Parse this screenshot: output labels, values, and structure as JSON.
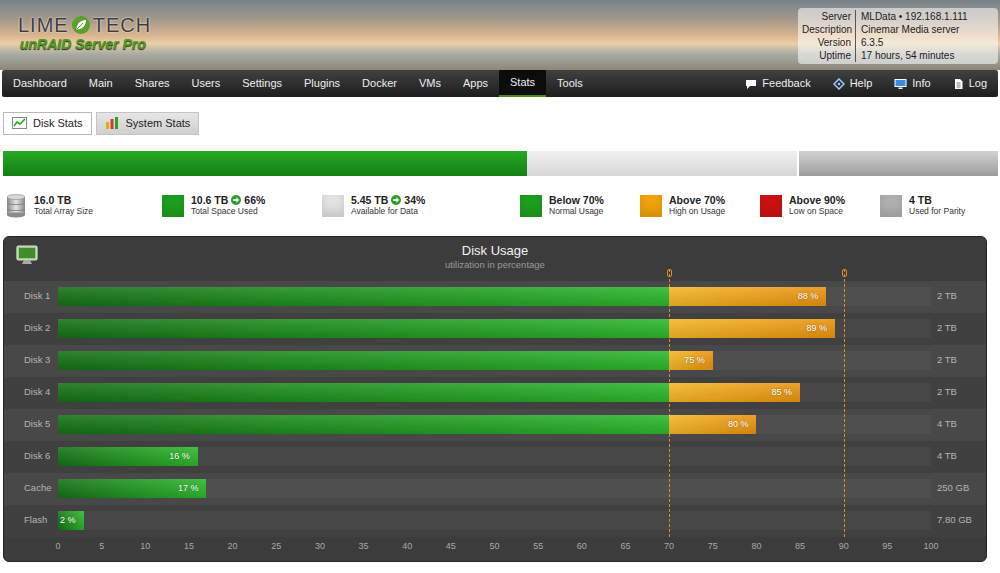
{
  "header": {
    "logo": {
      "left": "LIME",
      "right": "TECH",
      "product": "unRAID Server Pro"
    },
    "info": [
      {
        "label": "Server",
        "value": "MLData • 192.168.1.111"
      },
      {
        "label": "Description",
        "value": "Cinemar Media server"
      },
      {
        "label": "Version",
        "value": "6.3.5"
      },
      {
        "label": "Uptime",
        "value": "17 hours, 54 minutes"
      }
    ]
  },
  "nav": {
    "items": [
      {
        "label": "Dashboard",
        "selected": false
      },
      {
        "label": "Main",
        "selected": false
      },
      {
        "label": "Shares",
        "selected": false
      },
      {
        "label": "Users",
        "selected": false
      },
      {
        "label": "Settings",
        "selected": false
      },
      {
        "label": "Plugins",
        "selected": false
      },
      {
        "label": "Docker",
        "selected": false
      },
      {
        "label": "VMs",
        "selected": false
      },
      {
        "label": "Apps",
        "selected": false
      },
      {
        "label": "Stats",
        "selected": true
      },
      {
        "label": "Tools",
        "selected": false
      }
    ],
    "right": [
      {
        "label": "Feedback",
        "kind": "feedback"
      },
      {
        "label": "Help",
        "kind": "help"
      },
      {
        "label": "Info",
        "kind": "info"
      },
      {
        "label": "Log",
        "kind": "log"
      }
    ]
  },
  "tabs": [
    {
      "label": "Disk Stats",
      "selected": true
    },
    {
      "label": "System Stats",
      "selected": false
    }
  ],
  "usage_bar": {
    "used_level": 0.66,
    "parity_level": 0.2
  },
  "legend": [
    {
      "kind": "disk",
      "value": "16.0 TB",
      "caption": "Total Array Size"
    },
    {
      "kind": "swatch",
      "color": "#1e9e1e",
      "value": "10.6 TB",
      "percent": "66%",
      "caption": "Total Space Used"
    },
    {
      "kind": "swatch",
      "color": "#e2e2e2",
      "value": "5.45 TB",
      "percent": "34%",
      "caption": "Available for Data"
    },
    {
      "kind": "swatch",
      "color": "#1e9e1e",
      "value": "Below 70%",
      "caption": "Normal Usage"
    },
    {
      "kind": "swatch",
      "color": "#f0a30a",
      "value": "Above 70%",
      "caption": "High on Usage"
    },
    {
      "kind": "swatch",
      "color": "#cc1111",
      "value": "Above 90%",
      "caption": "Low on Space"
    },
    {
      "kind": "swatch",
      "color": "#b0b0b0",
      "value": "4 TB",
      "caption": "Used for Parity"
    }
  ],
  "chart": {
    "title": "Disk Usage",
    "subtitle": "utilization in percentage",
    "thresholds": [
      70,
      90
    ],
    "ticks": [
      "0",
      "5",
      "10",
      "15",
      "20",
      "25",
      "30",
      "35",
      "40",
      "45",
      "50",
      "55",
      "60",
      "65",
      "70",
      "75",
      "80",
      "85",
      "90",
      "95",
      "100"
    ],
    "rows": [
      {
        "name": "Disk 1",
        "value": 88,
        "label": "88 %",
        "size": "2 TB"
      },
      {
        "name": "Disk 2",
        "value": 89,
        "label": "89 %",
        "size": "2 TB"
      },
      {
        "name": "Disk 3",
        "value": 75,
        "label": "75 %",
        "size": "2 TB"
      },
      {
        "name": "Disk 4",
        "value": 85,
        "label": "85 %",
        "size": "2 TB"
      },
      {
        "name": "Disk 5",
        "value": 80,
        "label": "80 %",
        "size": "4 TB"
      },
      {
        "name": "Disk 6",
        "value": 16,
        "label": "16 %",
        "size": "4 TB"
      },
      {
        "name": "Cache",
        "value": 17,
        "label": "17 %",
        "size": "250 GB"
      },
      {
        "name": "Flash",
        "value": 2,
        "label": "2 %",
        "size": "7.80 GB"
      }
    ]
  }
}
